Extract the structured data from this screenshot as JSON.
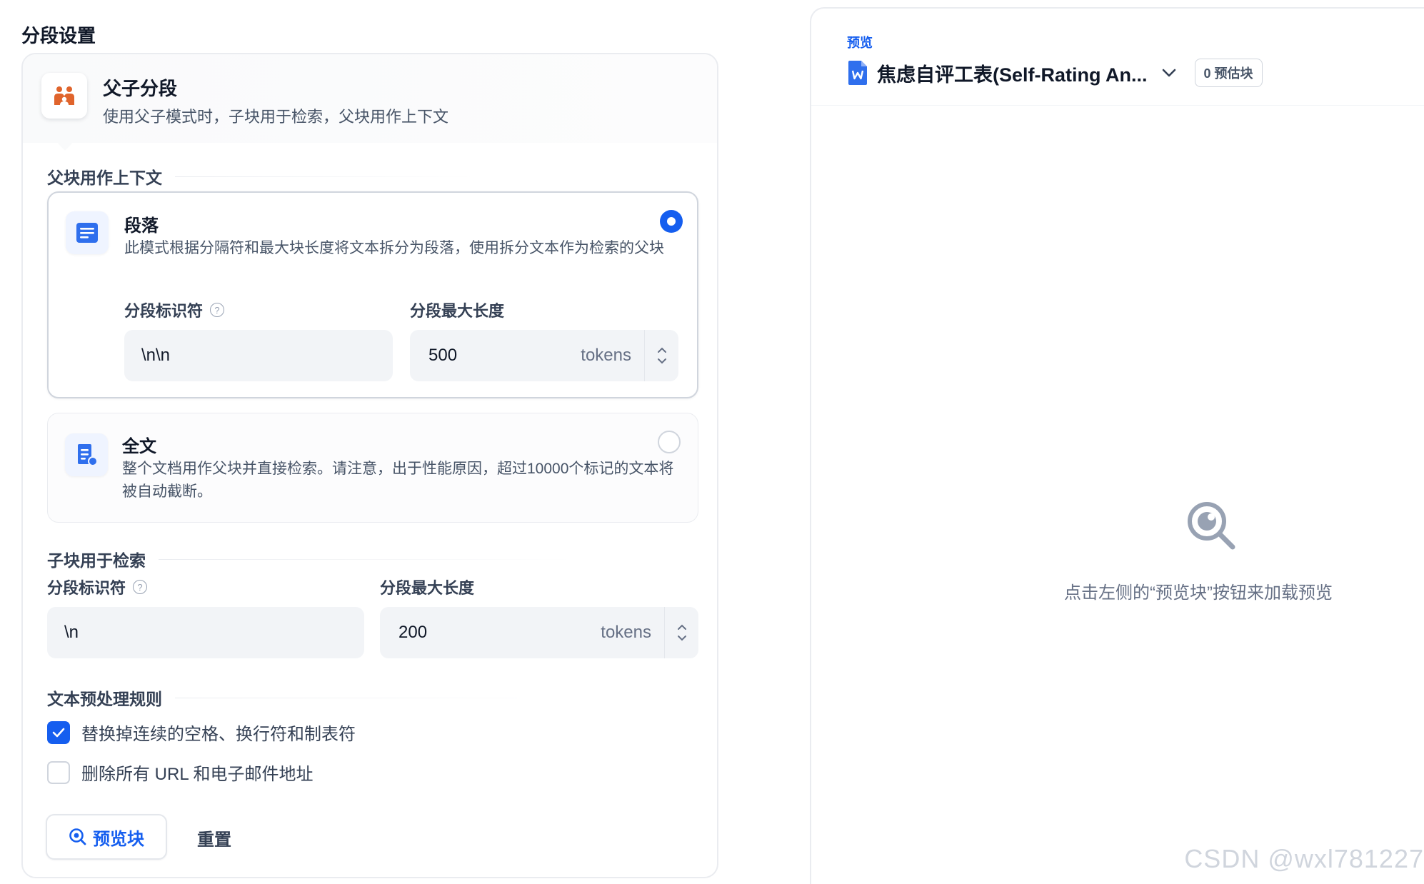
{
  "settings": {
    "title": "分段设置",
    "mode": {
      "title": "父子分段",
      "description": "使用父子模式时，子块用于检索，父块用作上下文"
    },
    "parent": {
      "label": "父块用作上下文",
      "paragraph": {
        "title": "段落",
        "description": "此模式根据分隔符和最大块长度将文本拆分为段落，使用拆分文本作为检索的父块",
        "selected": true,
        "delimiter_label": "分段标识符",
        "delimiter_value": "\\n\\n",
        "max_length_label": "分段最大长度",
        "max_length_value": "500",
        "unit": "tokens"
      },
      "fulltext": {
        "title": "全文",
        "description": "整个文档用作父块并直接检索。请注意，出于性能原因，超过10000个标记的文本将被自动截断。",
        "selected": false
      }
    },
    "child": {
      "label": "子块用于检索",
      "delimiter_label": "分段标识符",
      "delimiter_value": "\\n",
      "max_length_label": "分段最大长度",
      "max_length_value": "200",
      "unit": "tokens"
    },
    "preprocess": {
      "label": "文本预处理规则",
      "rules": [
        {
          "label": "替换掉连续的空格、换行符和制表符",
          "checked": true
        },
        {
          "label": "删除所有 URL 和电子邮件地址",
          "checked": false
        }
      ]
    },
    "buttons": {
      "preview": "预览块",
      "reset": "重置"
    }
  },
  "preview": {
    "label": "预览",
    "document_name": "焦虑自评工表(Self-Rating An...",
    "estimate_badge": "0 预估块",
    "empty_text": "点击左侧的“预览块”按钮来加载预览"
  },
  "watermark": "CSDN @wxl781227",
  "colors": {
    "accent": "#155eef",
    "mode_icon": "#e0642c"
  },
  "icons": {
    "mode": "parent-child-icon",
    "paragraph": "paragraph-icon",
    "fulltext": "document-icon",
    "doc": "word-doc-icon",
    "empty": "search-eye-icon"
  }
}
